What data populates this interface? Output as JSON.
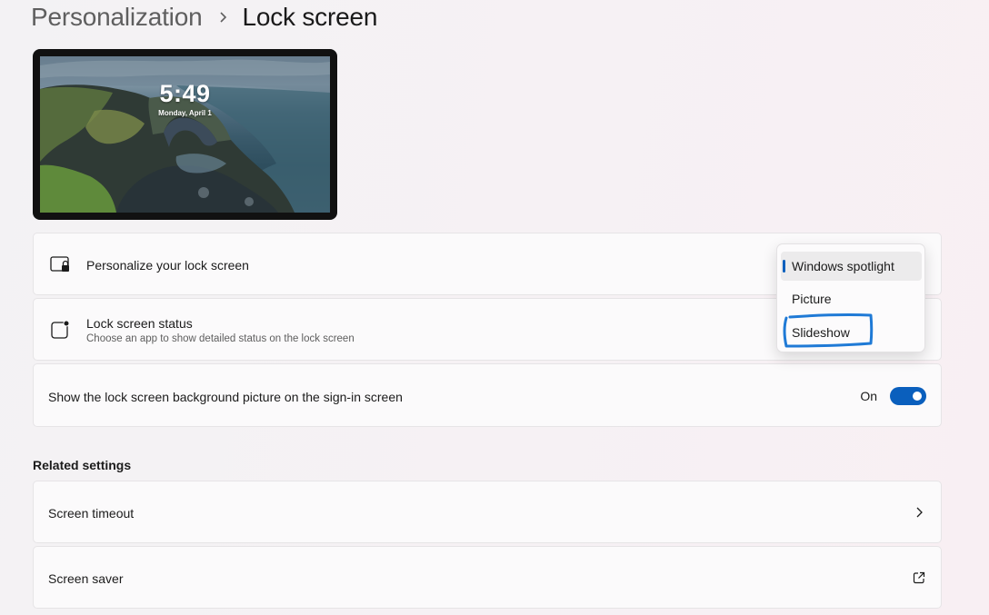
{
  "breadcrumb": {
    "parent": "Personalization",
    "current": "Lock screen"
  },
  "preview": {
    "time": "5:49",
    "date": "Monday, April 1"
  },
  "settings": {
    "personalize": {
      "title": "Personalize your lock screen",
      "icon": "lock-screen-icon"
    },
    "status": {
      "title": "Lock screen status",
      "subtitle": "Choose an app to show detailed status on the lock screen",
      "icon": "status-app-icon"
    },
    "signin": {
      "title": "Show the lock screen background picture on the sign-in screen",
      "state_label": "On",
      "enabled": true
    }
  },
  "related": {
    "heading": "Related settings",
    "items": [
      {
        "label": "Screen timeout",
        "icon": "chevron-right-icon"
      },
      {
        "label": "Screen saver",
        "icon": "external-link-icon"
      }
    ]
  },
  "dropdown": {
    "options": [
      "Windows spotlight",
      "Picture",
      "Slideshow"
    ],
    "selected": "Windows spotlight",
    "annotated": "Slideshow"
  },
  "colors": {
    "accent": "#0a5fbd",
    "annotation": "#1f7ad6"
  }
}
